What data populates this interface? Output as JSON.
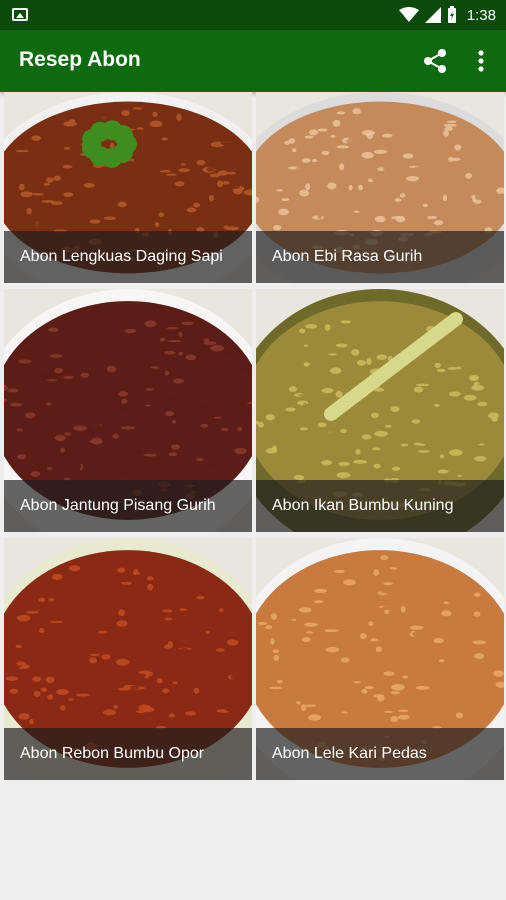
{
  "status_bar": {
    "time": "1:38"
  },
  "app_bar": {
    "title": "Resep Abon",
    "share_icon": "share-icon",
    "more_icon": "more-vert-icon"
  },
  "recipes": [
    {
      "label": "Abon Lengkuas Daging Sapi",
      "bg": "#7a2f12",
      "accent": "#b5592a",
      "plate": "#f1f1f1"
    },
    {
      "label": "Abon Ebi Rasa Gurih",
      "bg": "#c58a5a",
      "accent": "#e9c39b",
      "plate": "#dcdcdc"
    },
    {
      "label": "Abon Jantung Pisang Gurih",
      "bg": "#5b1d16",
      "accent": "#8a3a2c",
      "plate": "#f6f6f6"
    },
    {
      "label": "Abon Ikan Bumbu Kuning",
      "bg": "#9a8a3a",
      "accent": "#cdbb5e",
      "plate": "#6e6a2a"
    },
    {
      "label": "Abon Rebon Bumbu Opor",
      "bg": "#8a2a14",
      "accent": "#c24b22",
      "plate": "#e8ead0"
    },
    {
      "label": "Abon Lele Kari Pedas",
      "bg": "#c97a3e",
      "accent": "#e9a866",
      "plate": "#f4f4f4"
    }
  ]
}
